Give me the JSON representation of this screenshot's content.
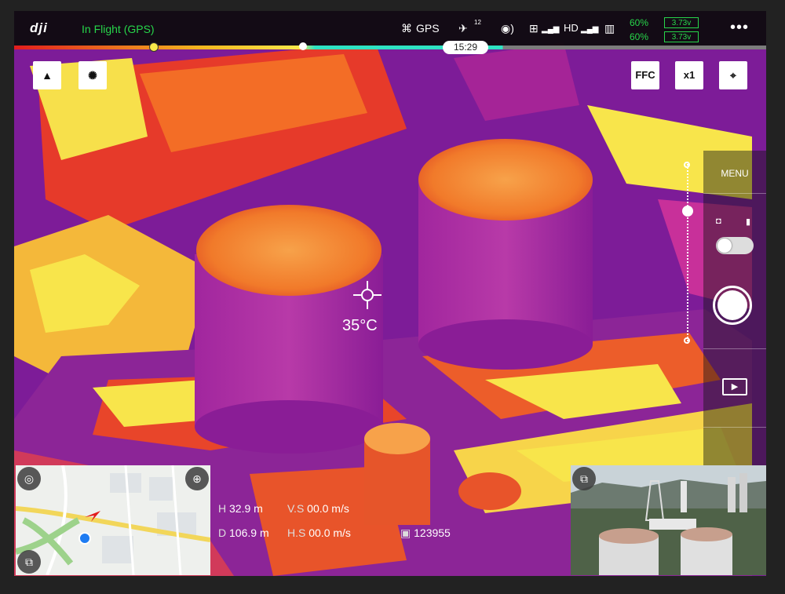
{
  "app": {
    "logo": "dji"
  },
  "status": {
    "flight_mode": "In Flight (GPS)",
    "gps_label": "GPS",
    "satellite_count": "12",
    "hd_label": "HD",
    "battery_top_pct": "60%",
    "battery_bottom_pct": "60%",
    "voltage_top": "3.73v",
    "voltage_bottom": "3.73v",
    "more_label": "•••"
  },
  "flight_time": "15:29",
  "camera_controls": {
    "ffc_label": "FFC",
    "zoom_label": "x1"
  },
  "right_panel": {
    "menu_label": "MENU"
  },
  "measurement": {
    "spot_temperature": "35°C"
  },
  "telemetry": {
    "h_label": "H",
    "h_value": "32.9 m",
    "vs_label": "V.S",
    "vs_value": "00.0 m/s",
    "d_label": "D",
    "d_value": "106.9 m",
    "hs_label": "H.S",
    "hs_value": "00.0 m/s",
    "sd_value": "123955"
  },
  "icons": {
    "logo": "dji-logo",
    "drone": "drone-icon",
    "satellite": "satellite-icon",
    "signal": "signal-icon",
    "remote": "remote-controller-icon",
    "battery": "battery-icon",
    "more": "more-icon",
    "map_layer": "map-layer-icon",
    "light": "light-bulb-icon",
    "focus": "focus-target-icon",
    "photo": "photo-camera-icon",
    "video": "video-camera-icon",
    "playback": "playback-icon",
    "compass": "compass-icon",
    "locate": "locate-icon",
    "switch_view": "switch-view-icon",
    "sd_card": "sd-card-icon"
  },
  "colors": {
    "status_green": "#27d64a",
    "timeline_red": "#e21d1d",
    "timeline_cyan": "#2ee3c2",
    "thermal_purple": "#8b1fa0",
    "thermal_orange": "#f06a1f",
    "thermal_yellow": "#f8e54b"
  }
}
